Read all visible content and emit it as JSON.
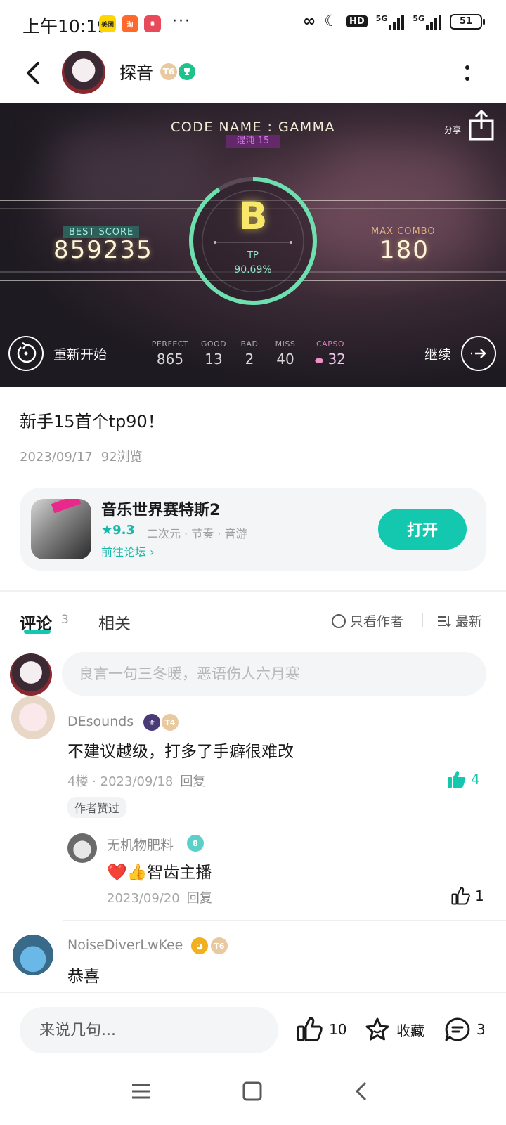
{
  "status_bar": {
    "time": "上午10:19",
    "dots": "···",
    "network": "HD",
    "signal1": "5G",
    "signal2": "5G",
    "battery": "51"
  },
  "header": {
    "username": "探音",
    "level_badge": "T6"
  },
  "game_result": {
    "song_title": "CODE NAME : GAMMA",
    "difficulty": "混沌 15",
    "share_label": "分享",
    "best_score_label": "BEST SCORE",
    "best_score": "859235",
    "max_combo_label": "MAX COMBO",
    "max_combo": "180",
    "grade": "B",
    "tp_label": "TP",
    "tp_value": "90.69%",
    "tp_progress": 0.9069,
    "restart_label": "重新开始",
    "continue_label": "继续",
    "stats": [
      {
        "key": "PERFECT",
        "value": "865"
      },
      {
        "key": "GOOD",
        "value": "13"
      },
      {
        "key": "BAD",
        "value": "2"
      },
      {
        "key": "MISS",
        "value": "40"
      },
      {
        "key": "CAPSO",
        "value": "32"
      }
    ],
    "accent_color": "#6ee0b0"
  },
  "post": {
    "title": "新手15首个tp90！",
    "date": "2023/09/17",
    "views": "92浏览"
  },
  "game_card": {
    "name": "音乐世界赛特斯2",
    "rating": "9.3",
    "tags": "二次元 · 节奏 · 音游",
    "forum_link": "前往论坛",
    "open_button": "打开"
  },
  "tabs": {
    "comments": "评论",
    "comments_count": "3",
    "related": "相关",
    "author_only": "只看作者",
    "sort": "最新"
  },
  "comment_input": {
    "placeholder": "良言一句三冬暖，恶语伤人六月寒"
  },
  "comments": [
    {
      "name": "DEsounds",
      "level": "T4",
      "text": "不建议越级，打多了手癖很难改",
      "floor": "4楼",
      "date": "2023/09/18",
      "reply": "回复",
      "likes": "4",
      "author_liked": "作者赞过",
      "replies": [
        {
          "name": "无机物肥料",
          "level": "8",
          "text": "❤️👍智齿主播",
          "date": "2023/09/20",
          "reply": "回复",
          "likes": "1"
        }
      ]
    },
    {
      "name": "NoiseDiverLwKee",
      "level": "T6",
      "text": "恭喜"
    }
  ],
  "bottom_bar": {
    "placeholder": "来说几句...",
    "likes": "10",
    "favorite": "收藏",
    "comments": "3"
  },
  "colors": {
    "brand": "#14c8b0",
    "text": "#1a1a1a",
    "muted": "#9a9a9a"
  }
}
